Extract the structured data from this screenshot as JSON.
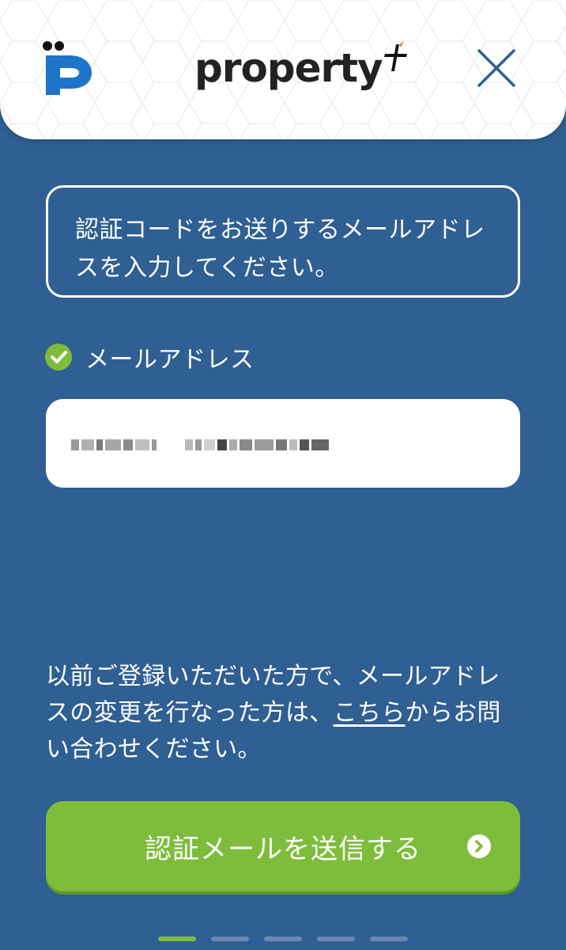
{
  "header": {
    "brand": "property",
    "close_label": "close"
  },
  "info_box": {
    "line1": "認証コードをお送りするメールアドレ",
    "line2": "スを入力してください。"
  },
  "email_field": {
    "label": "メールアドレス",
    "value": ""
  },
  "notice": {
    "part1": "以前ご登録いただいた方で、メールアドレスの変更を行なった方は、",
    "link": "こちら",
    "part2": "からお問い合わせください。"
  },
  "submit": {
    "label": "認証メールを送信する"
  },
  "pager": {
    "total": 5,
    "active_index": 0
  },
  "colors": {
    "background": "#2f5f93",
    "accent_green": "#7ebd3c",
    "logo_blue": "#1e74c8"
  }
}
